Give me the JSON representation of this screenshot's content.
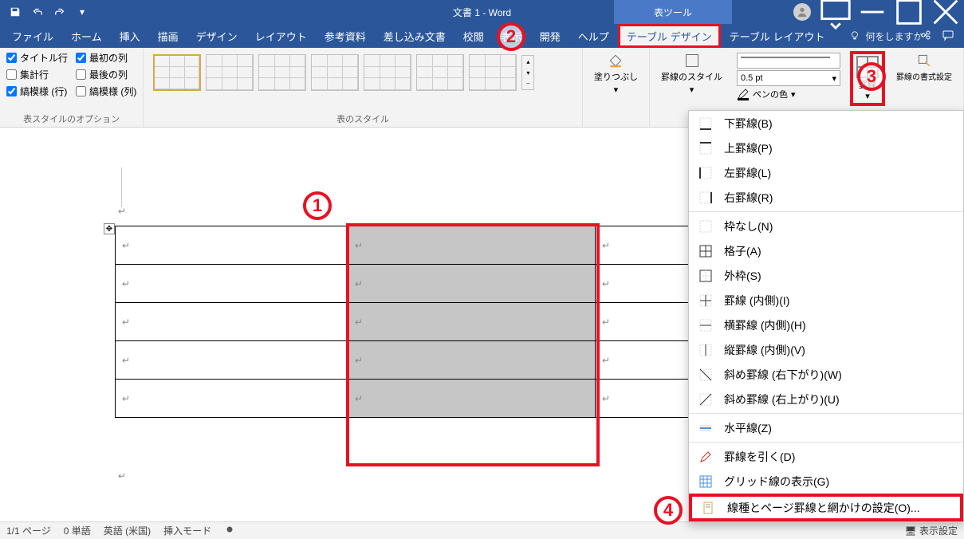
{
  "title": "文書 1 - Word",
  "table_tool": "表ツール",
  "qat": {
    "save": "save",
    "undo": "undo",
    "redo": "redo"
  },
  "tabs": {
    "file": "ファイル",
    "home": "ホーム",
    "insert": "挿入",
    "draw": "描画",
    "design": "デザイン",
    "layout": "レイアウト",
    "references": "参考資料",
    "mailings": "差し込み文書",
    "review": "校閲",
    "view": "表示",
    "developer": "開発",
    "help": "ヘルプ",
    "table_design": "テーブル デザイン",
    "table_layout": "テーブル レイアウト"
  },
  "tell_me": "何をしますか",
  "style_options": {
    "header_row": "タイトル行",
    "first_col": "最初の列",
    "total_row": "集計行",
    "last_col": "最後の列",
    "banded_rows": "縞模様 (行)",
    "banded_cols": "縞模様 (列)",
    "group_label": "表スタイルのオプション"
  },
  "styles_group_label": "表のスタイル",
  "shading_label": "塗りつぶし",
  "border_styles_label": "罫線のスタイル",
  "line_weight": "0.5 pt",
  "pen_color_label": "ペンの色",
  "borders_btn": "罫線",
  "border_painter": "罫線の書式設定",
  "dropdown": {
    "bottom": "下罫線(B)",
    "top": "上罫線(P)",
    "left": "左罫線(L)",
    "right": "右罫線(R)",
    "none": "枠なし(N)",
    "all": "格子(A)",
    "outside": "外枠(S)",
    "inside": "罫線 (内側)(I)",
    "inside_h": "横罫線 (内側)(H)",
    "inside_v": "縦罫線 (内側)(V)",
    "diag_down": "斜め罫線 (右下がり)(W)",
    "diag_up": "斜め罫線 (右上がり)(U)",
    "hline": "水平線(Z)",
    "draw": "罫線を引く(D)",
    "gridlines": "グリッド線の表示(G)",
    "settings": "線種とページ罫線と網かけの設定(O)..."
  },
  "status": {
    "page": "1/1 ページ",
    "words": "0 単語",
    "lang": "英語 (米国)",
    "insert_mode": "挿入モード",
    "display_settings": "表示設定"
  },
  "annotations": {
    "a1": "1",
    "a2": "2",
    "a3": "3",
    "a4": "4"
  }
}
